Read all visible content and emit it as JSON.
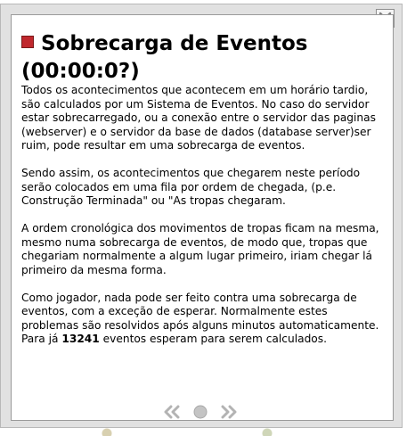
{
  "dialog": {
    "title": "Sobrecarga de Eventos (00:00:0?)",
    "paragraphs": {
      "p1": "Todos os acontecimentos que acontecem em um horário tardio, são calculados por um Sistema de Eventos. No caso do servidor estar sobrecarregado, ou a conexão entre o servidor das paginas (webserver) e o servidor da base de dados (database server)ser ruim, pode resultar em uma sobrecarga de eventos.",
      "p2": "Sendo assim, os acontecimentos que chegarem neste período serão colocados em uma fila por ordem de chegada, (p.e. Construção Terminada\" ou \"As tropas chegaram.",
      "p3": "A ordem cronológica dos movimentos de tropas ficam na mesma, mesmo numa sobrecarga de eventos, de modo que, tropas que chegariam normalmente a algum lugar primeiro, iriam chegar lá primeiro da mesma forma.",
      "p4_before": "Como jogador, nada pode ser feito contra uma sobrecarga de eventos, com a exceção de esperar. Normalmente estes problemas são resolvidos após alguns minutos automaticamente. Para já ",
      "p4_count": "13241",
      "p4_after": " eventos esperam para serem calculados."
    }
  },
  "icons": {
    "close": "close-icon",
    "title_marker": "square-red-icon",
    "prev": "double-chevron-left-icon",
    "page_dot": "circle-icon",
    "next": "double-chevron-right-icon"
  },
  "colors": {
    "frame": "#e1e1e1",
    "title_marker": "#c0282d",
    "pager": "#b3b3b3"
  }
}
